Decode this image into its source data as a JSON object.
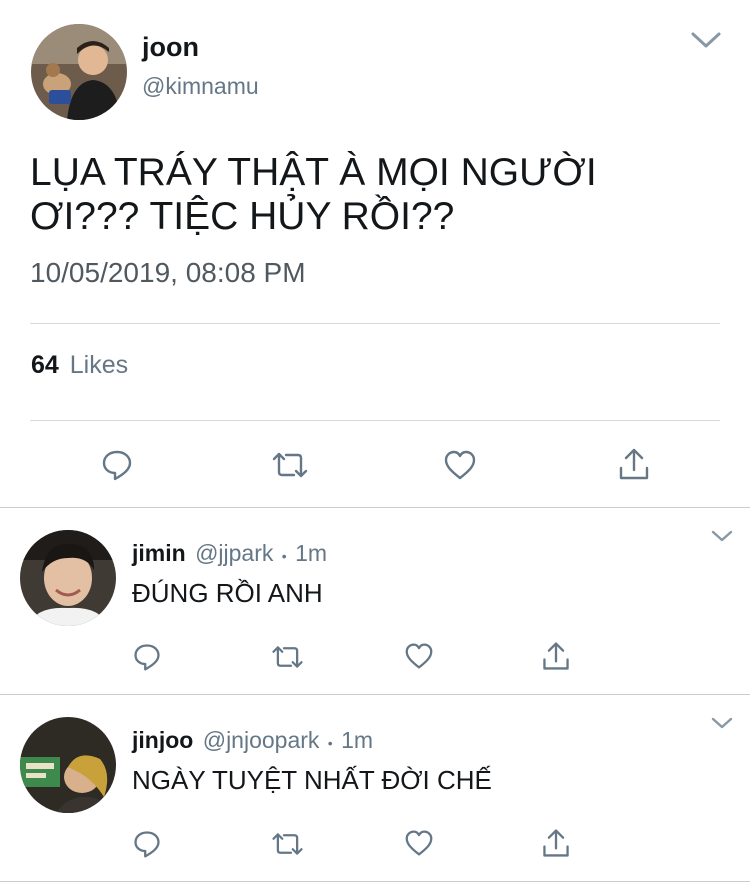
{
  "tweet": {
    "author_name": "joon",
    "author_handle": "@kimnamu",
    "text_line1": "LỤA TRÁY THẬT À MỌI NGƯỜI",
    "text_line2": "ƠI??? TIỆC HỦY RỒI??",
    "timestamp": "10/05/2019, 08:08 PM",
    "likes_count": "64",
    "likes_label": "Likes"
  },
  "replies": [
    {
      "name": "jimin",
      "handle": "@jjpark",
      "separator": "•",
      "time": "1m",
      "text": "ĐÚNG RỒI ANH"
    },
    {
      "name": "jinjoo",
      "handle": "@jnjoopark",
      "separator": "•",
      "time": "1m",
      "text": "NGÀY TUYỆT NHẤT ĐỜI CHẾ"
    }
  ],
  "icons": {
    "reply": "reply-icon",
    "retweet": "retweet-icon",
    "like": "heart-icon",
    "share": "share-icon",
    "menu": "chevron-down-icon"
  },
  "colors": {
    "text": "#14171a",
    "secondary": "#657786",
    "divider": "#d6dbe0",
    "icon": "#657786"
  }
}
